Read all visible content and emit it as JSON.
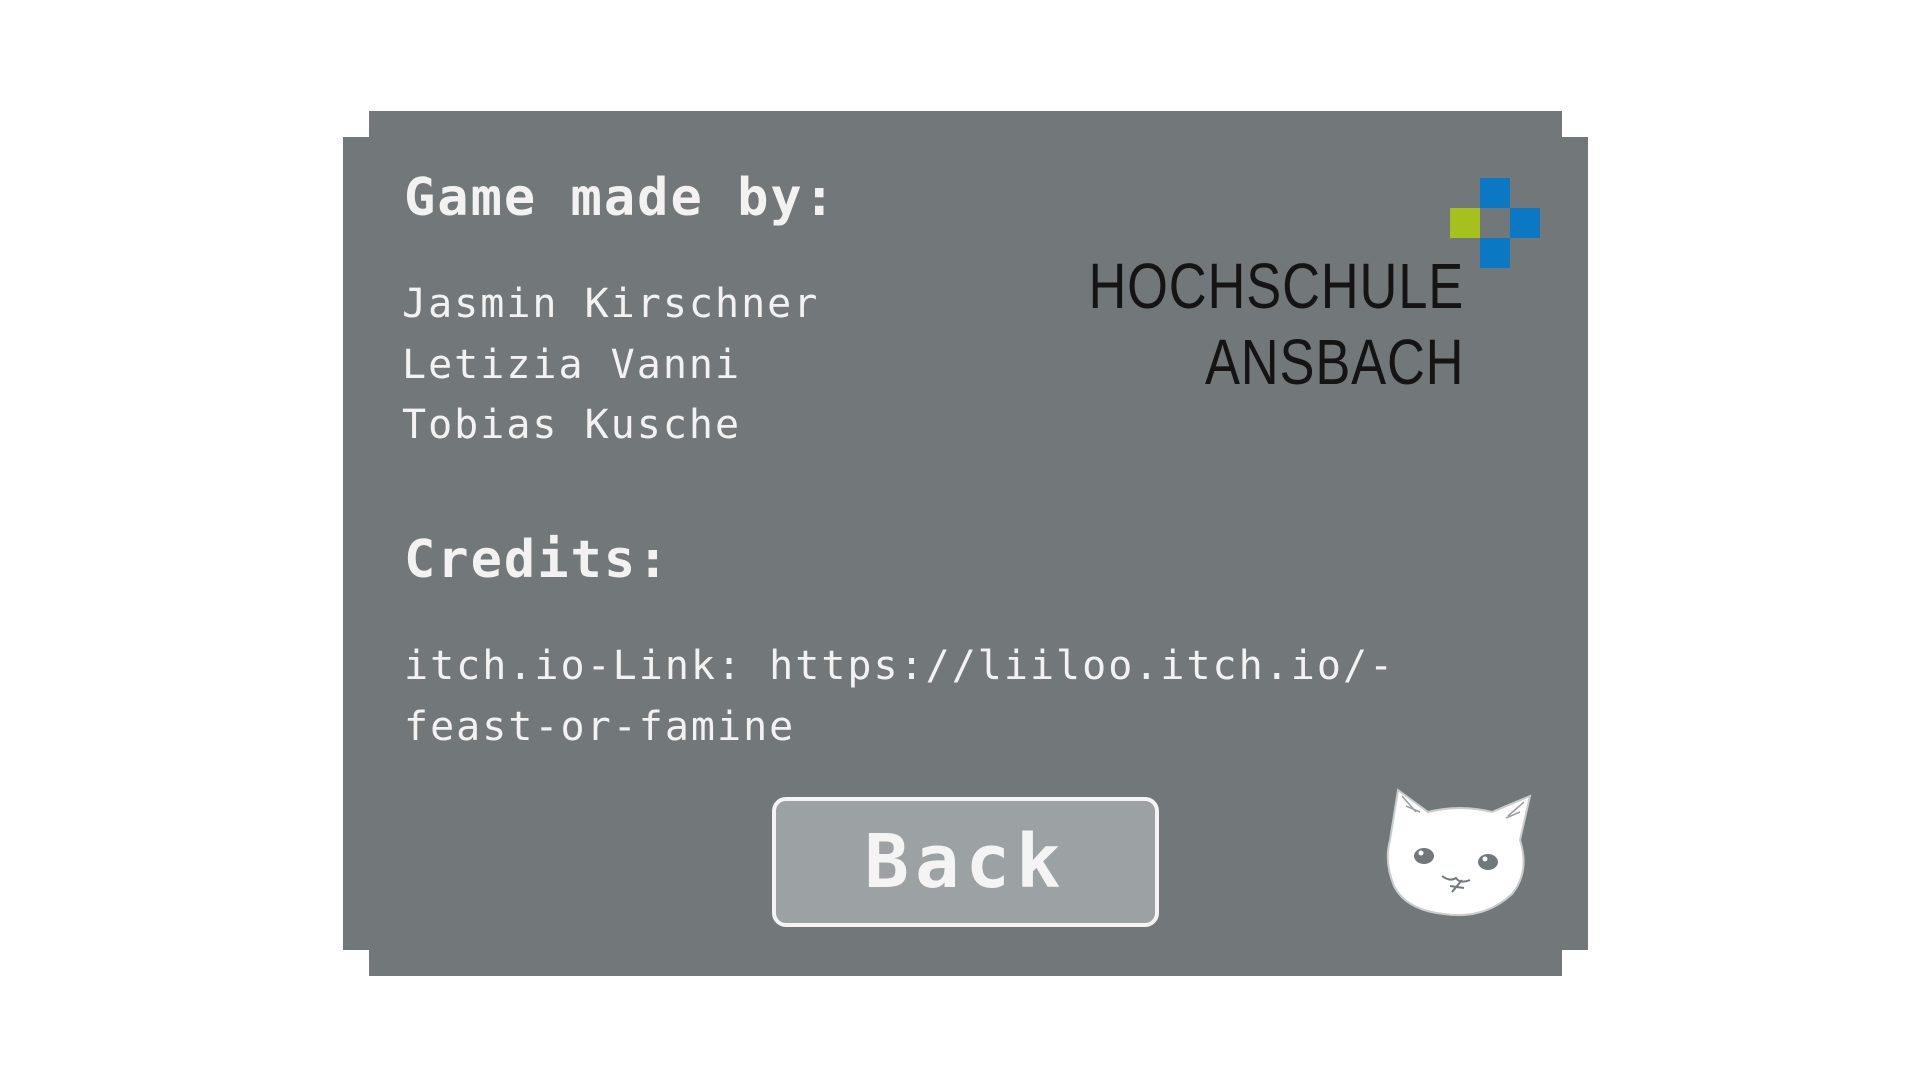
{
  "credits_screen": {
    "made_by_heading": "Game made by:",
    "authors": [
      "Jasmin Kirschner",
      "Letizia Vanni",
      "Tobias Kusche"
    ],
    "credits_heading": "Credits:",
    "link_lines": [
      "itch.io-Link: https://liiloo.itch.io/-",
      "feast-or-famine"
    ],
    "back_label": "Back"
  },
  "logo": {
    "line_1": "HOCHSCHULE",
    "line_2": "ANSBACH",
    "colors": {
      "blue": "#0a78c3",
      "green": "#a7c11c",
      "text": "#141414"
    }
  },
  "colors": {
    "panel": "#72787a",
    "button": "#9ca1a3",
    "text": "#f2f2f2",
    "background": "#ffffff"
  },
  "icons": {
    "mascot": "cat-face-icon"
  }
}
